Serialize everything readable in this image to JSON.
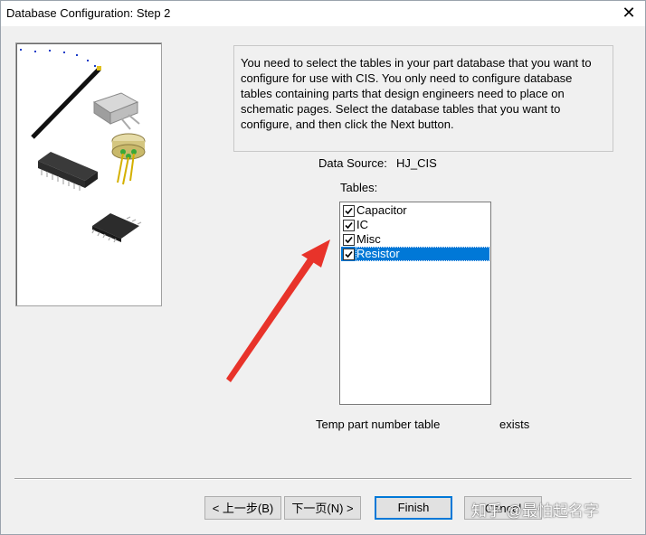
{
  "window": {
    "title": "Database Configuration: Step 2",
    "close_glyph": "✕"
  },
  "instructions": "You need to select the tables in your part database that you want to configure for use with CIS. You only need to configure database tables containing parts that design engineers need to place on schematic pages. Select the database tables that you want to configure, and then click the Next button.",
  "data_source": {
    "label": "Data Source:",
    "value": "HJ_CIS"
  },
  "tables": {
    "label": "Tables:",
    "items": [
      {
        "label": "Capacitor",
        "checked": true,
        "selected": false
      },
      {
        "label": "IC",
        "checked": true,
        "selected": false
      },
      {
        "label": "Misc",
        "checked": true,
        "selected": false
      },
      {
        "label": "Resistor",
        "checked": true,
        "selected": true
      }
    ]
  },
  "temp_table": {
    "label": "Temp part number table",
    "status": "exists"
  },
  "buttons": {
    "back": "< 上一步(B)",
    "next": "下一页(N) >",
    "finish": "Finish",
    "cancel": "Cancel"
  },
  "watermark": "知乎 @最怕起名字",
  "colors": {
    "selection": "#0078d7",
    "arrow": "#e8332a",
    "default_border": "#0078d7"
  }
}
